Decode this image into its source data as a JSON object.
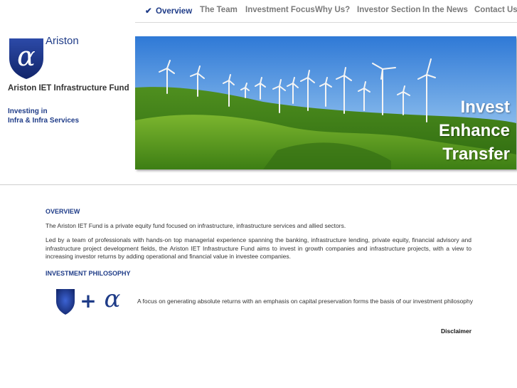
{
  "nav": {
    "items": [
      {
        "label": "Overview",
        "active": true
      },
      {
        "label": "The Team",
        "active": false
      },
      {
        "label": "Investment Focus",
        "active": false
      },
      {
        "label": "Why Us?",
        "active": false
      },
      {
        "label": "Investor Section",
        "active": false
      },
      {
        "label": "In the News",
        "active": false
      },
      {
        "label": "Contact Us",
        "active": false
      }
    ],
    "active_icon": "checkmark-icon"
  },
  "brand": {
    "name": "Ariston",
    "fund_name": "Ariston IET Infrastructure Fund",
    "tagline_line1": "Investing in",
    "tagline_line2": "Infra & Infra Services",
    "logo_icon": "shield-alpha-logo"
  },
  "hero": {
    "line1": "Invest",
    "line2": "Enhance",
    "line3": "Transfer",
    "image": "wind-turbines-on-green-hills"
  },
  "overview": {
    "heading": "OVERVIEW",
    "p1": "The Ariston IET Fund is a private equity fund focused on infrastructure, infrastructure services and allied sectors.",
    "p2": "Led by a team of professionals with hands-on top managerial experience spanning the banking, infrastructure lending, private equity, financial advisory and infrastructure project development fields, the Ariston IET Infrastructure Fund aims to invest in growth companies and infrastructure projects, with a view to increasing investor returns by adding operational and financial value in investee companies."
  },
  "philosophy": {
    "heading": "INVESTMENT PHILOSOPHY",
    "text": "A focus on generating absolute returns with an emphasis on capital preservation forms the basis of our investment philosophy",
    "graphic": "shield-plus-alpha-icon"
  },
  "footer": {
    "disclaimer": "Disclaimer"
  },
  "colors": {
    "brand_blue": "#1f3c88",
    "nav_gray": "#7a7a7a",
    "text": "#333333"
  }
}
